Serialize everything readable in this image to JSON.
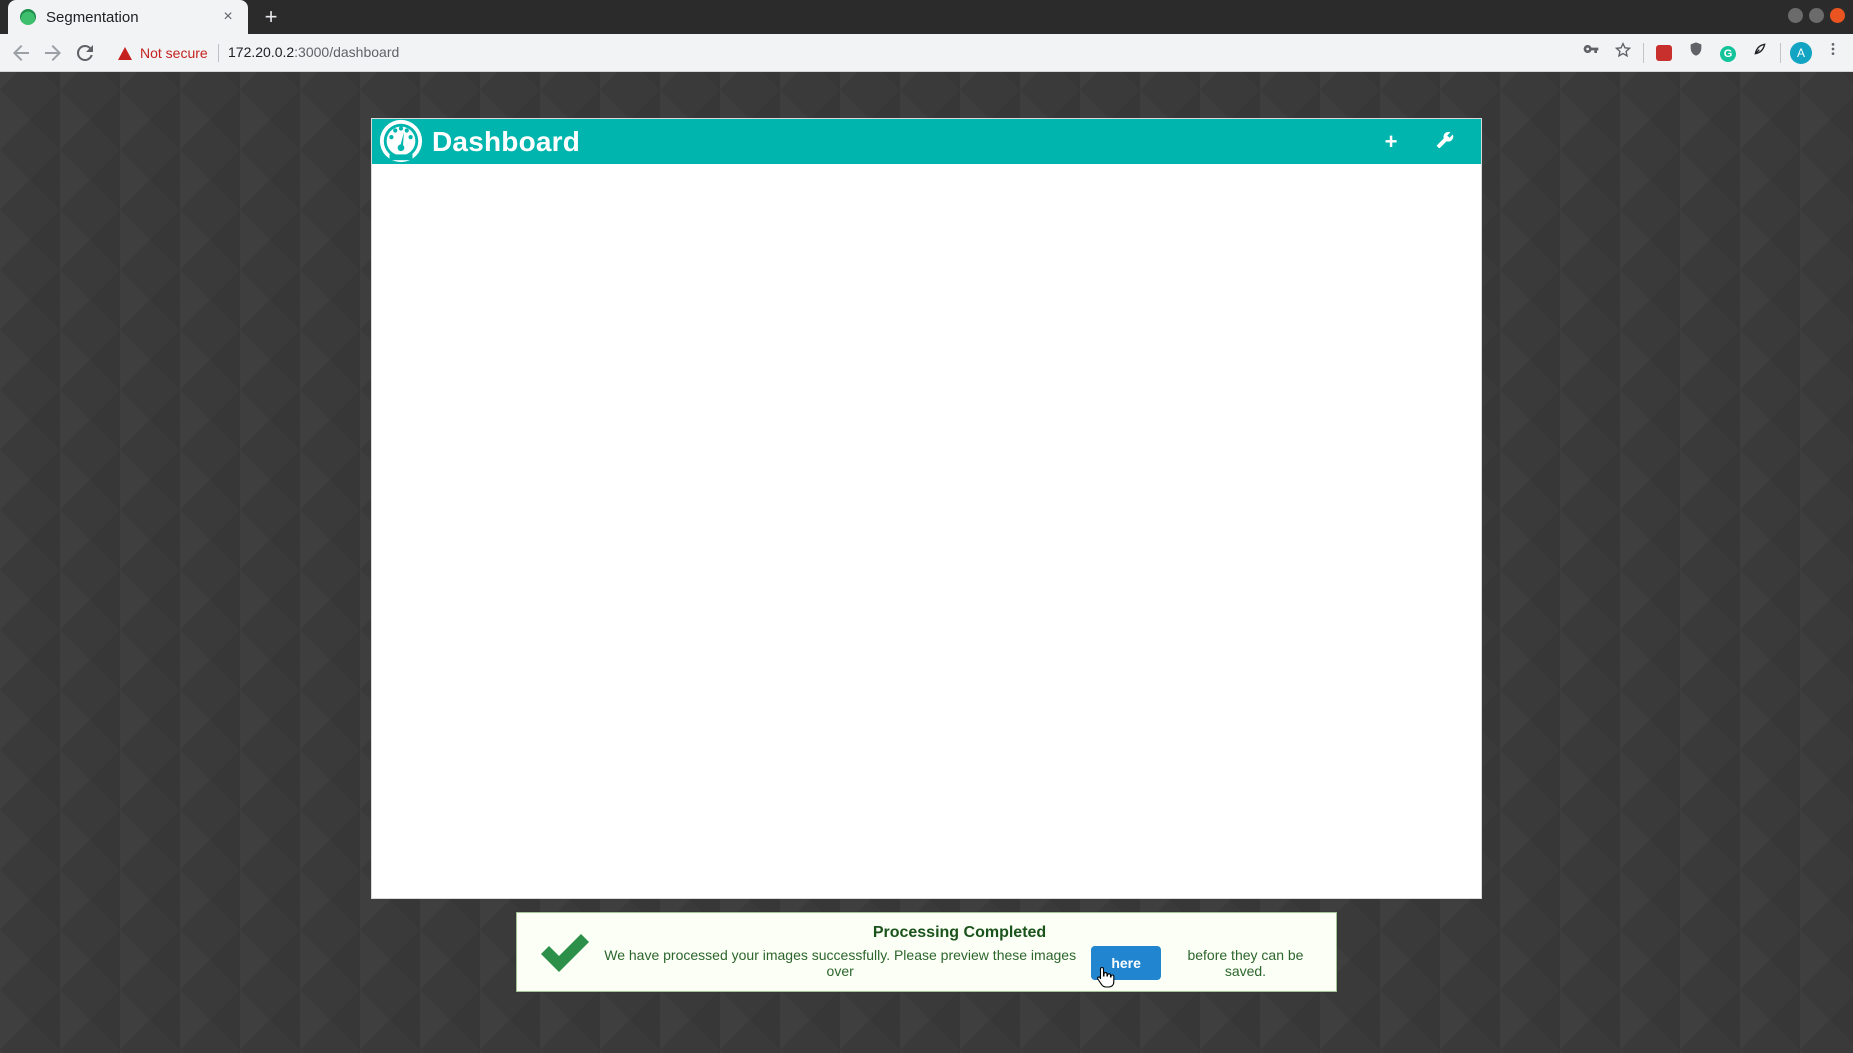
{
  "browser": {
    "tab_title": "Segmentation",
    "tab_close": "×",
    "new_tab": "+",
    "security_label": "Not secure",
    "url_host": "172.20.0.2",
    "url_path": ":3000/dashboard",
    "avatar_letter": "A"
  },
  "dashboard": {
    "title": "Dashboard",
    "add_label": "+",
    "settings_label": "⚒"
  },
  "toast": {
    "title": "Processing Completed",
    "text_before": "We have processed your images successfully. Please preview these images over",
    "link_label": "here",
    "text_after": "before they can be saved."
  },
  "colors": {
    "header": "#00b5ad",
    "success_text": "#2c662d",
    "button": "#2185d0"
  }
}
